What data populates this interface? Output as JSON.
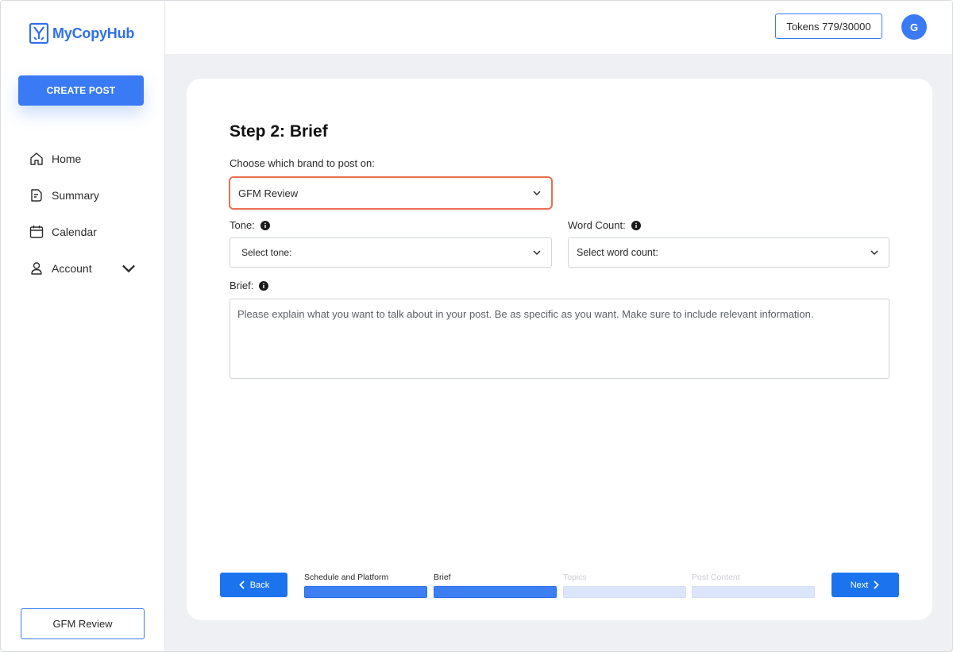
{
  "app": {
    "name": "MyCopyHub"
  },
  "sidebar": {
    "create_label": "CREATE POST",
    "items": [
      {
        "label": "Home",
        "icon": "home-icon"
      },
      {
        "label": "Summary",
        "icon": "summary-icon"
      },
      {
        "label": "Calendar",
        "icon": "calendar-icon"
      },
      {
        "label": "Account",
        "icon": "user-icon"
      }
    ],
    "brand_button": "GFM Review"
  },
  "topbar": {
    "tokens": "Tokens 779/30000",
    "avatar_initial": "G"
  },
  "form": {
    "title": "Step 2: Brief",
    "brand_label": "Choose which brand to post on:",
    "brand_value": "GFM Review",
    "tone_label": "Tone:",
    "tone_placeholder": "Select tone:",
    "word_count_label": "Word Count:",
    "word_count_placeholder": "Select word count:",
    "brief_label": "Brief:",
    "brief_placeholder": "Please explain what you want to talk about in your post. Be as specific as you want. Make sure to include relevant information."
  },
  "footer": {
    "back_label": "Back",
    "next_label": "Next",
    "steps": [
      {
        "label": "Schedule and Platform",
        "done": true
      },
      {
        "label": "Brief",
        "done": true
      },
      {
        "label": "Topics",
        "done": false
      },
      {
        "label": "Post Content",
        "done": false
      }
    ]
  },
  "colors": {
    "accent": "#3a7bf5",
    "highlight": "#e9704f"
  }
}
